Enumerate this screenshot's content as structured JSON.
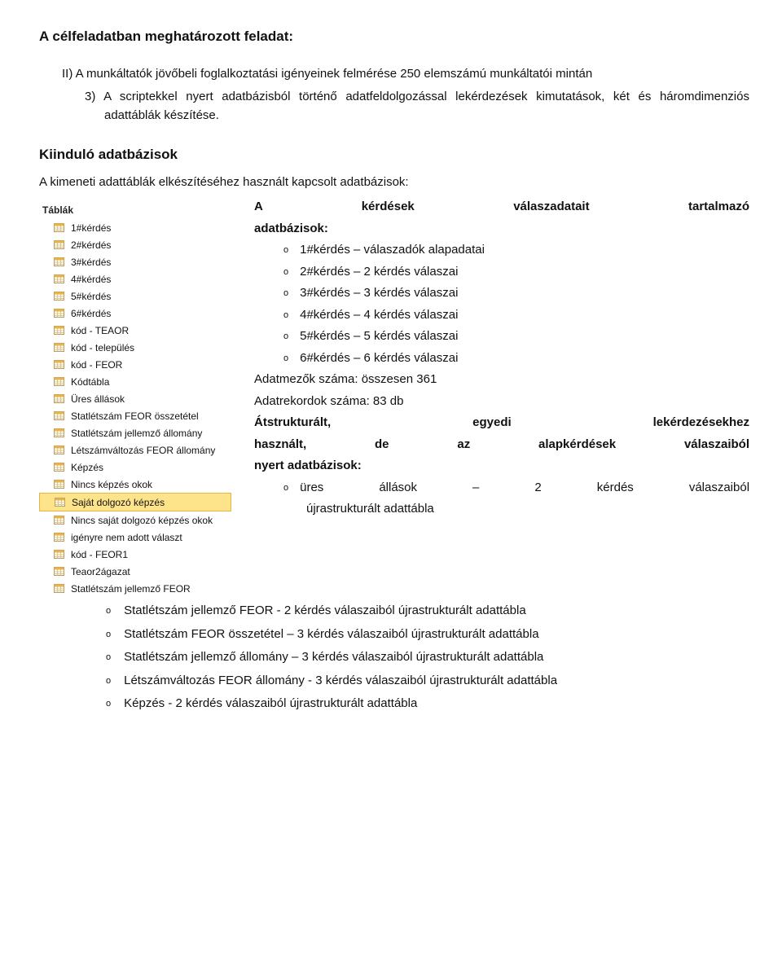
{
  "heading": "A célfeladatban meghatározott feladat:",
  "intro": {
    "line1": "II) A munkáltatók jövőbeli foglalkoztatási igényeinek felmérése 250 elemszámú munkáltatói mintán",
    "line2": "3) A scriptekkel nyert adatbázisból történő adatfeldolgozással lekérdezések kimutatások, két és háromdimenziós adattáblák készítése."
  },
  "subheading": "Kiinduló adatbázisok",
  "subintro": "A kimeneti adattáblák elkészítéséhez használt kapcsolt adatbázisok:",
  "sidebar": {
    "title": "Táblák",
    "items": [
      {
        "label": "1#kérdés",
        "highlight": false
      },
      {
        "label": "2#kérdés",
        "highlight": false
      },
      {
        "label": "3#kérdés",
        "highlight": false
      },
      {
        "label": "4#kérdés",
        "highlight": false
      },
      {
        "label": "5#kérdés",
        "highlight": false
      },
      {
        "label": "6#kérdés",
        "highlight": false
      },
      {
        "label": "kód - TEAOR",
        "highlight": false
      },
      {
        "label": "kód - település",
        "highlight": false
      },
      {
        "label": "kód - FEOR",
        "highlight": false
      },
      {
        "label": "Kódtábla",
        "highlight": false
      },
      {
        "label": "Üres állások",
        "highlight": false
      },
      {
        "label": "Statlétszám FEOR összetétel",
        "highlight": false
      },
      {
        "label": "Statlétszám jellemző állomány",
        "highlight": false
      },
      {
        "label": "Létszámváltozás FEOR állomány",
        "highlight": false
      },
      {
        "label": "Képzés",
        "highlight": false
      },
      {
        "label": "Nincs képzés okok",
        "highlight": false
      },
      {
        "label": "Saját dolgozó képzés",
        "highlight": true
      },
      {
        "label": "Nincs saját dolgozó képzés okok",
        "highlight": false
      },
      {
        "label": "igényre nem adott választ",
        "highlight": false
      },
      {
        "label": "kód - FEOR1",
        "highlight": false
      },
      {
        "label": "Teaor2ágazat",
        "highlight": false
      },
      {
        "label": "Statlétszám jellemző FEOR",
        "highlight": false
      }
    ]
  },
  "right": {
    "l1a": "A",
    "l1b": "kérdések",
    "l1c": "válaszadatait",
    "l1d": "tartalmazó",
    "l2": "adatbázisok:",
    "b1": "1#kérdés – válaszadók alapadatai",
    "b2": "2#kérdés – 2 kérdés válaszai",
    "b3": "3#kérdés – 3 kérdés válaszai",
    "b4": "4#kérdés – 4 kérdés válaszai",
    "b5": "5#kérdés – 5 kérdés válaszai",
    "b6": "6#kérdés – 6 kérdés válaszai",
    "p1": "Adatmezők száma: összesen 361",
    "p2": "Adatrekordok száma: 83 db",
    "s1a": "Átstrukturált,",
    "s1b": "egyedi",
    "s1c": "lekérdezésekhez",
    "s2": "használt, de az alapkérdések válaszaiból",
    "s3": "nyert adatbázisok:",
    "u1a": "üres",
    "u1b": "állások",
    "u1c": "–",
    "u1d": "2",
    "u1e": "kérdés",
    "u1f": "válaszaiból",
    "u2": "újrastrukturált adattábla"
  },
  "full": {
    "b1": "Statlétszám jellemző FEOR - 2 kérdés válaszaiból újrastrukturált adattábla",
    "b2": "Statlétszám FEOR összetétel – 3 kérdés válaszaiból újrastrukturált adattábla",
    "b3": "Statlétszám jellemző állomány – 3 kérdés válaszaiból újrastrukturált adattábla",
    "b4": "Létszámváltozás FEOR állomány - 3 kérdés válaszaiból újrastrukturált adattábla",
    "b5": "Képzés - 2 kérdés válaszaiból újrastrukturált adattábla"
  }
}
